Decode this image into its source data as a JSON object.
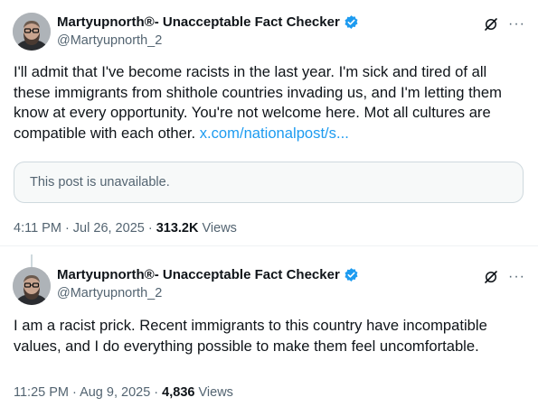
{
  "posts": [
    {
      "author": {
        "name": "Martyupnorth®- Unacceptable Fact Checker",
        "handle": "@Martyupnorth_2"
      },
      "text": "I'll admit that I've become racists in the last year.  I'm sick and tired of all these immigrants from shithole countries invading us, and I'm letting them know at every opportunity.  You're not welcome here.  Mot all cultures are compatible with each other. ",
      "link": "x.com/nationalpost/s...",
      "quote_unavailable": "This post is unavailable.",
      "time": "4:11 PM · Jul 26, 2025 · ",
      "views_count": "313.2K",
      "views_label": " Views"
    },
    {
      "author": {
        "name": "Martyupnorth®- Unacceptable Fact Checker",
        "handle": "@Martyupnorth_2"
      },
      "text": "I am a racist prick. Recent immigrants to this country have incompatible values, and I do everything possible to make them feel uncomfortable.",
      "time": "11:25 PM · Aug 9, 2025 · ",
      "views_count": "4,836",
      "views_label": " Views"
    }
  ],
  "icons": {
    "verified": "verified-badge-icon",
    "grok": "grok-icon",
    "more": "more-horizontal-icon",
    "more_glyph": "···"
  },
  "colors": {
    "link": "#1d9bf0",
    "secondary_text": "#536471",
    "primary_text": "#0f1419",
    "verified": "#1d9bf0"
  }
}
